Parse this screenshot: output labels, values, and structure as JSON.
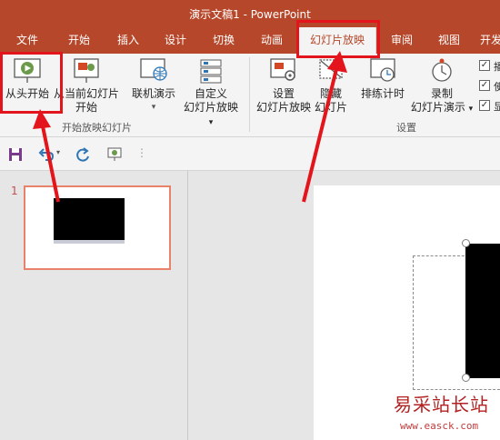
{
  "window": {
    "title": "演示文稿1 - PowerPoint"
  },
  "tabs": [
    {
      "label": "文件"
    },
    {
      "label": "开始"
    },
    {
      "label": "插入"
    },
    {
      "label": "设计"
    },
    {
      "label": "切换"
    },
    {
      "label": "动画"
    },
    {
      "label": "幻灯片放映"
    },
    {
      "label": "审阅"
    },
    {
      "label": "视图"
    },
    {
      "label": "开发"
    }
  ],
  "active_tab": "幻灯片放映",
  "ribbon": {
    "start_group": {
      "label": "开始放映幻灯片",
      "from_beginning": "从头开始",
      "from_current_l1": "从当前幻灯片",
      "from_current_l2": "开始",
      "online": "联机演示",
      "custom_l1": "自定义",
      "custom_l2": "幻灯片放映"
    },
    "setup_group": {
      "label": "设置",
      "setup_l1": "设置",
      "setup_l2": "幻灯片放映",
      "hide_l1": "隐藏",
      "hide_l2": "幻灯片",
      "rehearse": "排练计时",
      "record_l1": "录制",
      "record_l2": "幻灯片演示"
    },
    "checkboxes": [
      {
        "label": "播",
        "checked": true
      },
      {
        "label": "使",
        "checked": true
      },
      {
        "label": "显",
        "checked": true
      }
    ]
  },
  "thumbnails": [
    {
      "number": "1"
    }
  ],
  "watermark": {
    "text": "易采站长站",
    "url": "www.easck.com"
  },
  "colors": {
    "accent": "#b7472a",
    "highlight": "#e3141b",
    "thumb_border": "#e8826b"
  }
}
